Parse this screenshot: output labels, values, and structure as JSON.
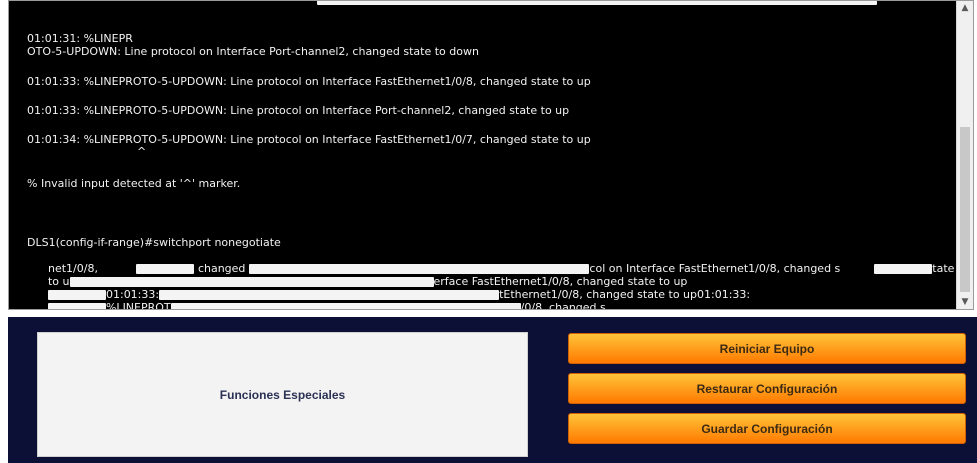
{
  "terminal": {
    "top_partial": "....................................................................................................",
    "line1a": "01:01:31: %LINEPR",
    "line1b": "OTO-5-UPDOWN: Line protocol on Interface Port-channel2, changed state to down",
    "line2": "01:01:33: %LINEPROTO-5-UPDOWN: Line protocol on Interface FastEthernet1/0/8, changed state to up",
    "line3": "01:01:33: %LINEPROTO-5-UPDOWN: Line protocol on Interface Port-channel2, changed state to up",
    "line4": "01:01:34: %LINEPROTO-5-UPDOWN: Line protocol on Interface FastEthernet1/0/7, changed state to up",
    "caret": "^",
    "error": "% Invalid input detected at '^' marker.",
    "prompt": "DLS1(config-if-range)#switchport nonegotiate",
    "garbled": [
      {
        "a": "net1/0/8,",
        "b": "changed",
        "c": "col on Interface FastEthernet1/0/8, changed s",
        "d": "tate"
      },
      {
        "a": "to u",
        "b": "erface FastEthernet1/0/8, changed state to up"
      },
      {
        "a": "01:01:33:",
        "b": "tEthernet1/0/8, changed state to up01:01:33:"
      },
      {
        "a": "%LINEPROT",
        "b": "/0/8, changed s"
      }
    ]
  },
  "panel": {
    "special_label": "Funciones Especiales",
    "buttons": {
      "reiniciar": "Reiniciar Equipo",
      "restaurar": "Restaurar Configuración",
      "guardar": "Guardar Configuración"
    }
  },
  "icons": {
    "scroll_up": "triangle-up",
    "scroll_down": "triangle-down"
  }
}
